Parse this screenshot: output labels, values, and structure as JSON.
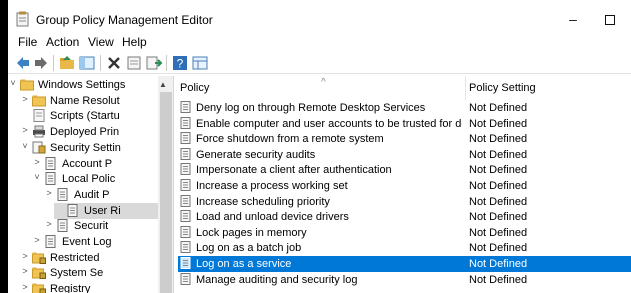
{
  "window": {
    "title": "Group Policy Management Editor",
    "min_glyph": "–",
    "accent": "#0078d7"
  },
  "menu": {
    "items": [
      "File",
      "Action",
      "View",
      "Help"
    ]
  },
  "toolbar": {
    "icons": [
      "back-icon",
      "forward-icon",
      "up-folder-icon",
      "show-hide-tree-icon",
      "delete-icon",
      "properties-icon",
      "export-list-icon",
      "help-icon",
      "view-icon"
    ]
  },
  "tree": {
    "items": [
      {
        "label": "Windows Settings",
        "expander": "˅",
        "icon": "folder-icon"
      },
      {
        "label": "Name Resolut",
        "expander": "˃",
        "icon": "folder-icon"
      },
      {
        "label": "Scripts (Startu",
        "expander": "",
        "icon": "script-icon"
      },
      {
        "label": "Deployed Prin",
        "expander": "˃",
        "icon": "printer-icon"
      },
      {
        "label": "Security Settin",
        "expander": "˅",
        "icon": "security-icon"
      },
      {
        "label": "Account P",
        "expander": "˃",
        "icon": "policy-icon"
      },
      {
        "label": "Local Polic",
        "expander": "˅",
        "icon": "policy-icon"
      },
      {
        "label": "Audit P",
        "expander": "˃",
        "icon": "policy-icon"
      },
      {
        "label": "User Ri",
        "expander": "",
        "icon": "policy-icon"
      },
      {
        "label": "Securit",
        "expander": "˃",
        "icon": "policy-icon"
      },
      {
        "label": "Event Log",
        "expander": "˃",
        "icon": "policy-icon"
      },
      {
        "label": "Restricted",
        "expander": "˃",
        "icon": "folder-lock-icon"
      },
      {
        "label": "System Se",
        "expander": "˃",
        "icon": "folder-lock-icon"
      },
      {
        "label": "Registry",
        "expander": "˃",
        "icon": "folder-lock-icon"
      }
    ]
  },
  "list": {
    "col_policy": "Policy",
    "col_setting": "Policy Setting",
    "rows": [
      {
        "policy": "Deny log on through Remote Desktop Services",
        "setting": "Not Defined"
      },
      {
        "policy": "Enable computer and user accounts to be trusted for delega...",
        "setting": "Not Defined"
      },
      {
        "policy": "Force shutdown from a remote system",
        "setting": "Not Defined"
      },
      {
        "policy": "Generate security audits",
        "setting": "Not Defined"
      },
      {
        "policy": "Impersonate a client after authentication",
        "setting": "Not Defined"
      },
      {
        "policy": "Increase a process working set",
        "setting": "Not Defined"
      },
      {
        "policy": "Increase scheduling priority",
        "setting": "Not Defined"
      },
      {
        "policy": "Load and unload device drivers",
        "setting": "Not Defined"
      },
      {
        "policy": "Lock pages in memory",
        "setting": "Not Defined"
      },
      {
        "policy": "Log on as a batch job",
        "setting": "Not Defined"
      },
      {
        "policy": "Log on as a service",
        "setting": "Not Defined",
        "selected": true
      },
      {
        "policy": "Manage auditing and security log",
        "setting": "Not Defined"
      }
    ]
  }
}
